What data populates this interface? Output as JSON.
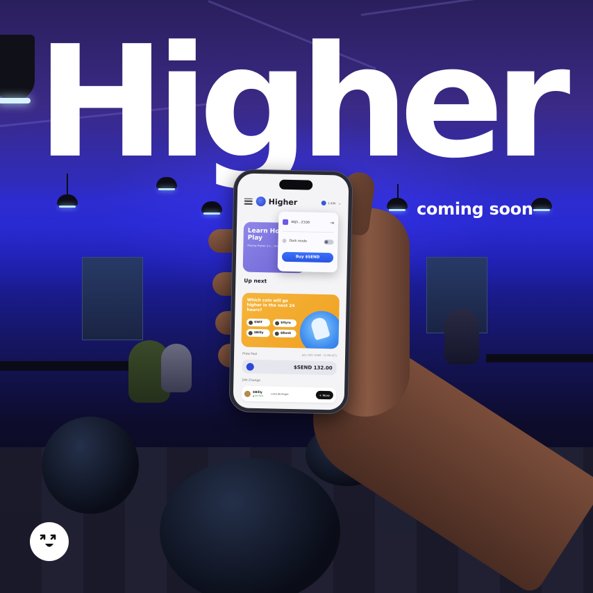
{
  "headline": "Higher",
  "subline": "coming soon",
  "phone": {
    "app_name": "Higher",
    "balance": "2.40K",
    "learn_card": {
      "title": "Learn How to Play",
      "body": "Playing Higher is s... check out the l..."
    },
    "dropdown": {
      "wallet": "46J5...Z1Q6",
      "dark_mode_label": "Dark mode",
      "dark_mode_on": false,
      "buy_button": "Buy $SEND"
    },
    "up_next": "Up next",
    "game_card": {
      "question": "Which coin will go higher in the next 24 hours?",
      "coins": [
        "$Wif",
        "$Hyro",
        "$Billy",
        "$Bonk"
      ]
    },
    "prize_pool": {
      "label": "Prize Pool",
      "date": "July 10th 12AM - 12 PM (ET)",
      "value": "$SEND 132.00"
    },
    "change": {
      "label": "24h Change",
      "coin": "$Billy",
      "coin_sub": "▲ 96.89%",
      "middle": "+$15.00 Bright",
      "more": "+ More"
    }
  },
  "colors": {
    "accent": "#2a54e0",
    "game_card": "#f5b53b",
    "learn_card": "#7b73df"
  }
}
